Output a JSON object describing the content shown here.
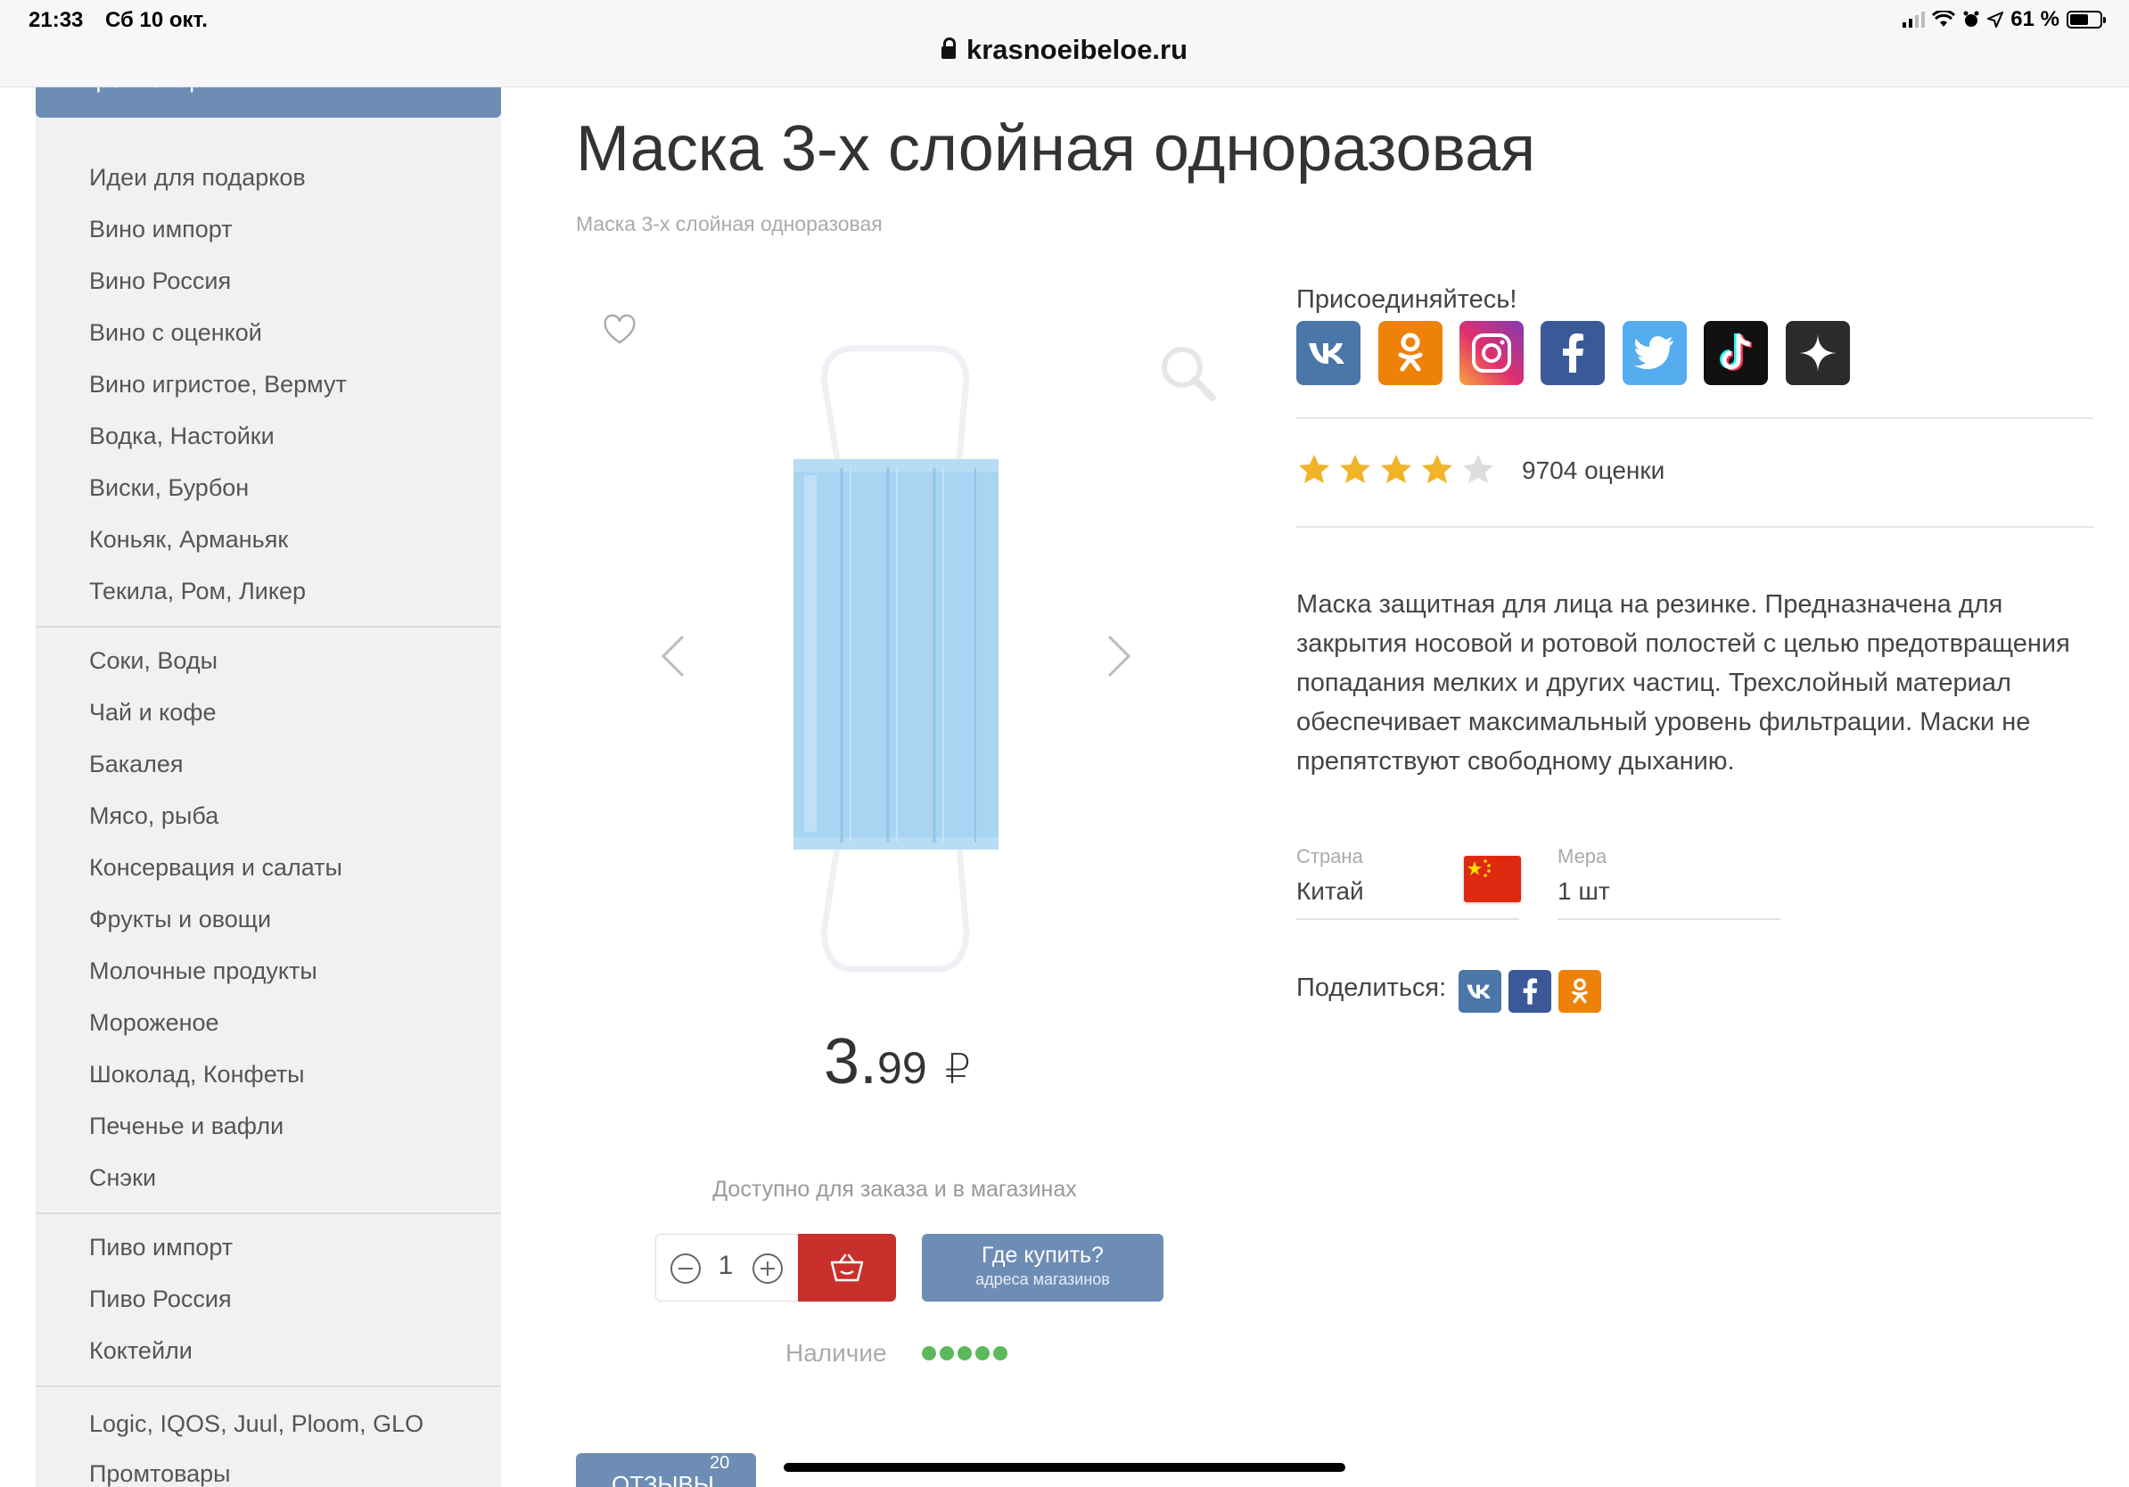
{
  "status_bar": {
    "time": "21:33",
    "date": "Сб 10 окт.",
    "url": "krasnoeibeloe.ru",
    "battery": "61 %"
  },
  "sidebar": {
    "header": "Промтовары",
    "groups": [
      [
        "Идеи для подарков",
        "Вино импорт",
        "Вино Россия",
        "Вино с оценкой",
        "Вино игристое, Вермут",
        "Водка, Настойки",
        "Виски, Бурбон",
        "Коньяк, Арманьяк",
        "Текила, Ром, Ликер"
      ],
      [
        "Соки, Воды",
        "Чай и кофе",
        "Бакалея",
        "Мясо, рыба",
        "Консервация и салаты",
        "Фрукты и овощи",
        "Молочные продукты",
        "Мороженое",
        "Шоколад, Конфеты",
        "Печенье и вафли",
        "Снэки"
      ],
      [
        "Пиво импорт",
        "Пиво Россия",
        "Коктейли"
      ],
      [
        "Logic, IQOS, Juul, Ploom, GLO",
        "Промтовары"
      ]
    ]
  },
  "product": {
    "title": "Маска 3-х слойная одноразовая",
    "breadcrumb": "Маска 3-х слойная одноразовая",
    "price_main": "3.",
    "price_cents": "99",
    "currency": "₽",
    "availability": "Доступно для заказа и в магазинах",
    "quantity": "1",
    "where_buy": "Где купить?",
    "where_buy_sub": "адреса магазинов",
    "stock_label": "Наличие",
    "stock_level": 5,
    "reviews_tab": "ОТЗЫВЫ",
    "reviews_count": "20"
  },
  "social": {
    "join_label": "Присоединяйтесь!",
    "networks": [
      {
        "name": "vk",
        "glyph": "vk",
        "color": "#4a76a8"
      },
      {
        "name": "odnoklassniki",
        "glyph": "ok",
        "color": "#ee8208"
      },
      {
        "name": "instagram",
        "glyph": "ig",
        "color": "#c13584"
      },
      {
        "name": "facebook",
        "glyph": "f",
        "color": "#3b5998"
      },
      {
        "name": "twitter",
        "glyph": "tw",
        "color": "#55acee"
      },
      {
        "name": "tiktok",
        "glyph": "tt",
        "color": "#111111"
      },
      {
        "name": "yandex-zen",
        "glyph": "zen",
        "color": "#2b2b2b"
      }
    ]
  },
  "rating": {
    "stars": 4,
    "max": 5,
    "count_label": "9704 оценки",
    "star_color": "#f0b429"
  },
  "description": "Маска защитная для лица на резинке. Предназначена для закрытия носовой и ротовой полостей с целью предотвращения попадания мелких и других частиц. Трехслойный материал обеспечивает максимальный уровень фильтрации. Маски не препятствуют свободному дыханию.",
  "specs": {
    "country_label": "Страна",
    "country_value": "Китай",
    "measure_label": "Мера",
    "measure_value": "1 шт"
  },
  "share": {
    "label": "Поделиться:"
  },
  "colors": {
    "accent": "#6e8db5",
    "cart": "#c9302c",
    "stock": "#5cb85c"
  }
}
